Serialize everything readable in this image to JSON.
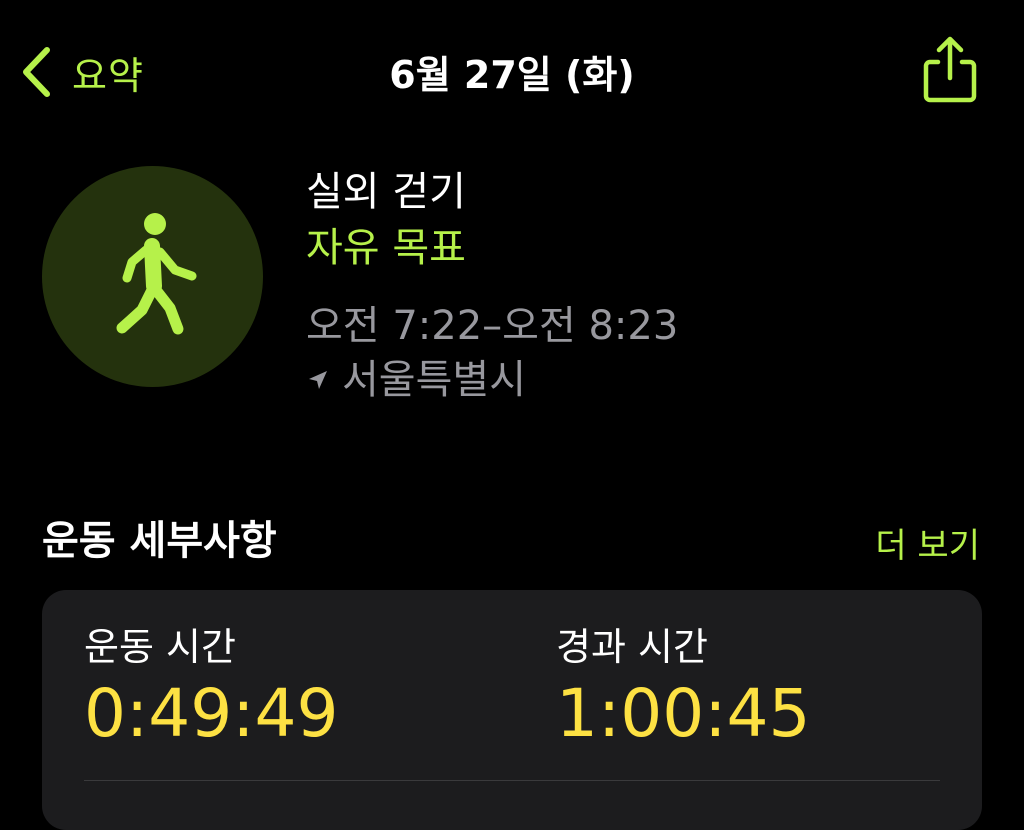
{
  "nav": {
    "back_label": "요약",
    "title": "6월 27일 (화)",
    "back_icon": "chevron-left-icon",
    "share_icon": "share-icon"
  },
  "workout": {
    "icon": "walking-figure-icon",
    "name": "실외 걷기",
    "goal": "자유 목표",
    "time_range": "오전 7:22–오전 8:23",
    "location_icon": "location-arrow-icon",
    "location": "서울특별시"
  },
  "details": {
    "section_title": "운동 세부사항",
    "show_more_label": "더 보기",
    "metrics": [
      {
        "label": "운동 시간",
        "value": "0:49:49"
      },
      {
        "label": "경과 시간",
        "value": "1:00:45"
      }
    ]
  },
  "colors": {
    "background": "#000000",
    "accent": "#b6f14a",
    "badge_background": "#24320d",
    "secondary_text": "#98989e",
    "card_background": "#1c1c1e",
    "metric_value": "#fde143"
  }
}
